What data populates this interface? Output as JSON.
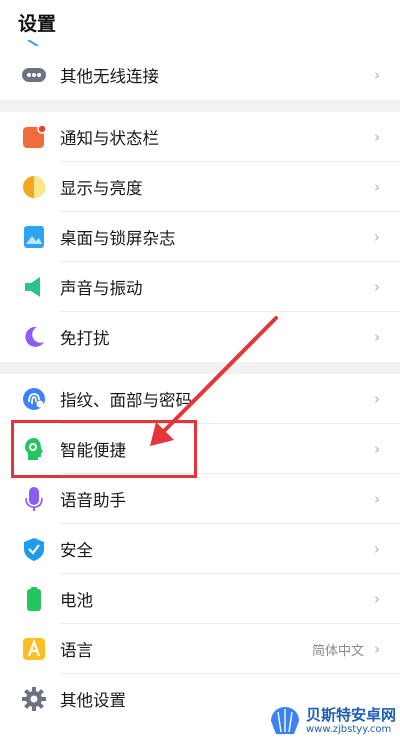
{
  "header": {
    "title": "设置"
  },
  "groups": [
    {
      "items": [
        {
          "label": "其他无线连接",
          "icon": "dots-icon",
          "color": "#6b7280"
        }
      ]
    },
    {
      "items": [
        {
          "label": "通知与状态栏",
          "icon": "notification-icon",
          "color": "#f26b3a"
        },
        {
          "label": "显示与亮度",
          "icon": "brightness-icon",
          "color": "#f5a623"
        },
        {
          "label": "桌面与锁屏杂志",
          "icon": "wallpaper-icon",
          "color": "#2ea4f2"
        },
        {
          "label": "声音与振动",
          "icon": "speaker-icon",
          "color": "#2bc38a"
        },
        {
          "label": "免打扰",
          "icon": "moon-icon",
          "color": "#8b5cf6"
        }
      ]
    },
    {
      "items": [
        {
          "label": "指纹、面部与密码",
          "icon": "fingerprint-icon",
          "color": "#3b82f6"
        },
        {
          "label": "智能便捷",
          "icon": "smart-head-icon",
          "color": "#22c55e"
        },
        {
          "label": "语音助手",
          "icon": "microphone-icon",
          "color": "#8b5cf6"
        },
        {
          "label": "安全",
          "icon": "shield-icon",
          "color": "#1d9bf0"
        },
        {
          "label": "电池",
          "icon": "battery-icon",
          "color": "#22c55e"
        },
        {
          "label": "语言",
          "icon": "language-icon",
          "color": "#fbbf24",
          "value": "简体中文"
        },
        {
          "label": "其他设置",
          "icon": "gear-icon",
          "color": "#6b7280"
        }
      ]
    }
  ],
  "chevron": "›",
  "watermark": {
    "title": "贝斯特安卓网",
    "url": "www.zjbstyy.com"
  },
  "annotation": {
    "color": "#e5353a"
  }
}
